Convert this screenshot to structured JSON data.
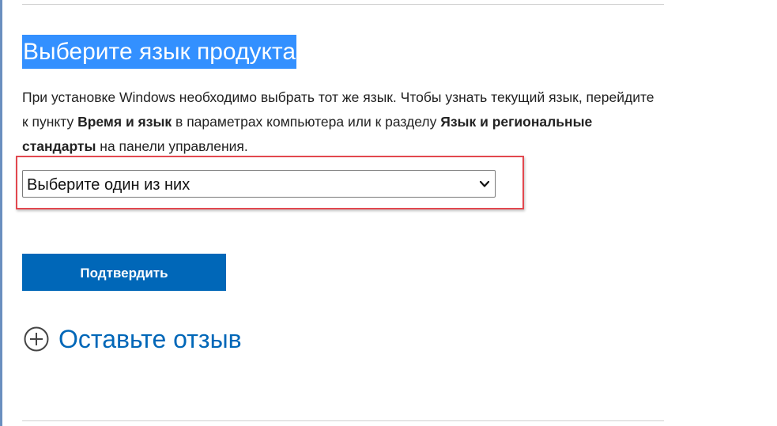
{
  "heading": "Выберите язык продукта",
  "description": {
    "part1": "При установке Windows необходимо выбрать тот же язык. Чтобы узнать текущий язык, перейдите к пункту ",
    "bold1": "Время и язык",
    "part2": " в параметрах компьютера или к разделу ",
    "bold2": "Язык и региональные стандарты",
    "part3": " на панели управления."
  },
  "language_select": {
    "selected": "Выберите один из них",
    "icon": "chevron-down-icon"
  },
  "confirm_button": {
    "label": "Подтвердить"
  },
  "feedback": {
    "label": "Оставьте отзыв",
    "icon": "plus-circle-icon"
  },
  "colors": {
    "accent": "#0067b8",
    "selection": "#3390ff",
    "highlight_border": "#e2484f"
  }
}
